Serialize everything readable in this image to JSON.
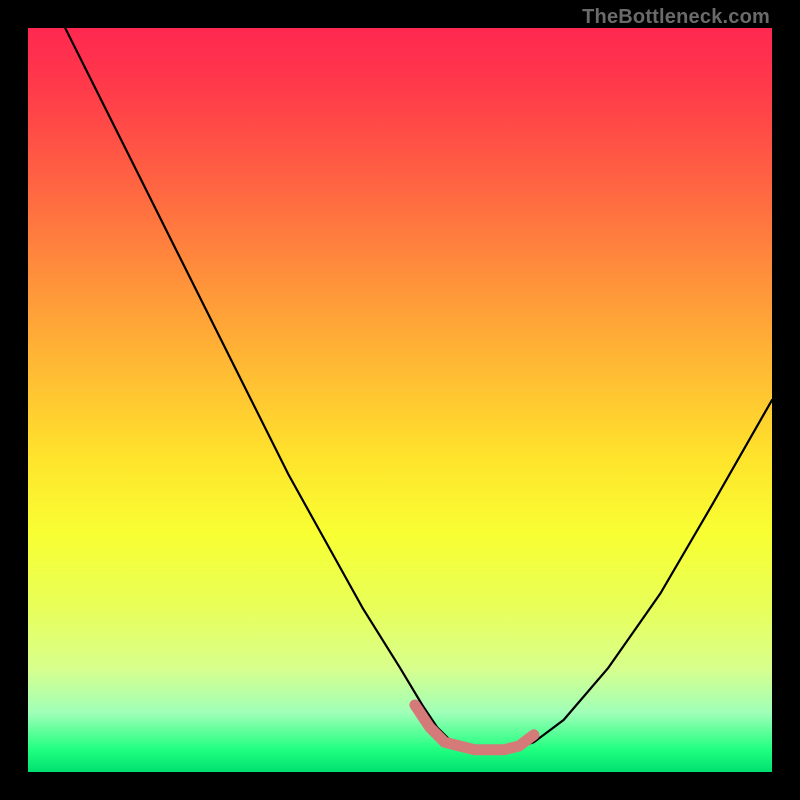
{
  "watermark": "TheBottleneck.com",
  "chart_data": {
    "type": "line",
    "title": "",
    "xlabel": "",
    "ylabel": "",
    "xlim": [
      0,
      100
    ],
    "ylim": [
      0,
      100
    ],
    "grid": false,
    "legend": false,
    "series": [
      {
        "name": "bottleneck-curve",
        "color": "#000000",
        "x": [
          5,
          10,
          15,
          20,
          25,
          30,
          35,
          40,
          45,
          50,
          53,
          55,
          57,
          60,
          63,
          65,
          68,
          72,
          78,
          85,
          92,
          100
        ],
        "y": [
          100,
          90,
          80,
          70,
          60,
          50,
          40,
          31,
          22,
          14,
          9,
          6,
          4,
          3,
          3,
          3,
          4,
          7,
          14,
          24,
          36,
          50
        ]
      },
      {
        "name": "highlight-zone",
        "color": "#d47a78",
        "x": [
          52,
          54,
          56,
          58,
          60,
          62,
          64,
          66,
          68
        ],
        "y": [
          9,
          6,
          4,
          3.5,
          3,
          3,
          3,
          3.5,
          5
        ]
      }
    ],
    "background_gradient": {
      "top": "#ff2850",
      "mid": "#ffe42c",
      "bottom": "#00e070"
    }
  }
}
